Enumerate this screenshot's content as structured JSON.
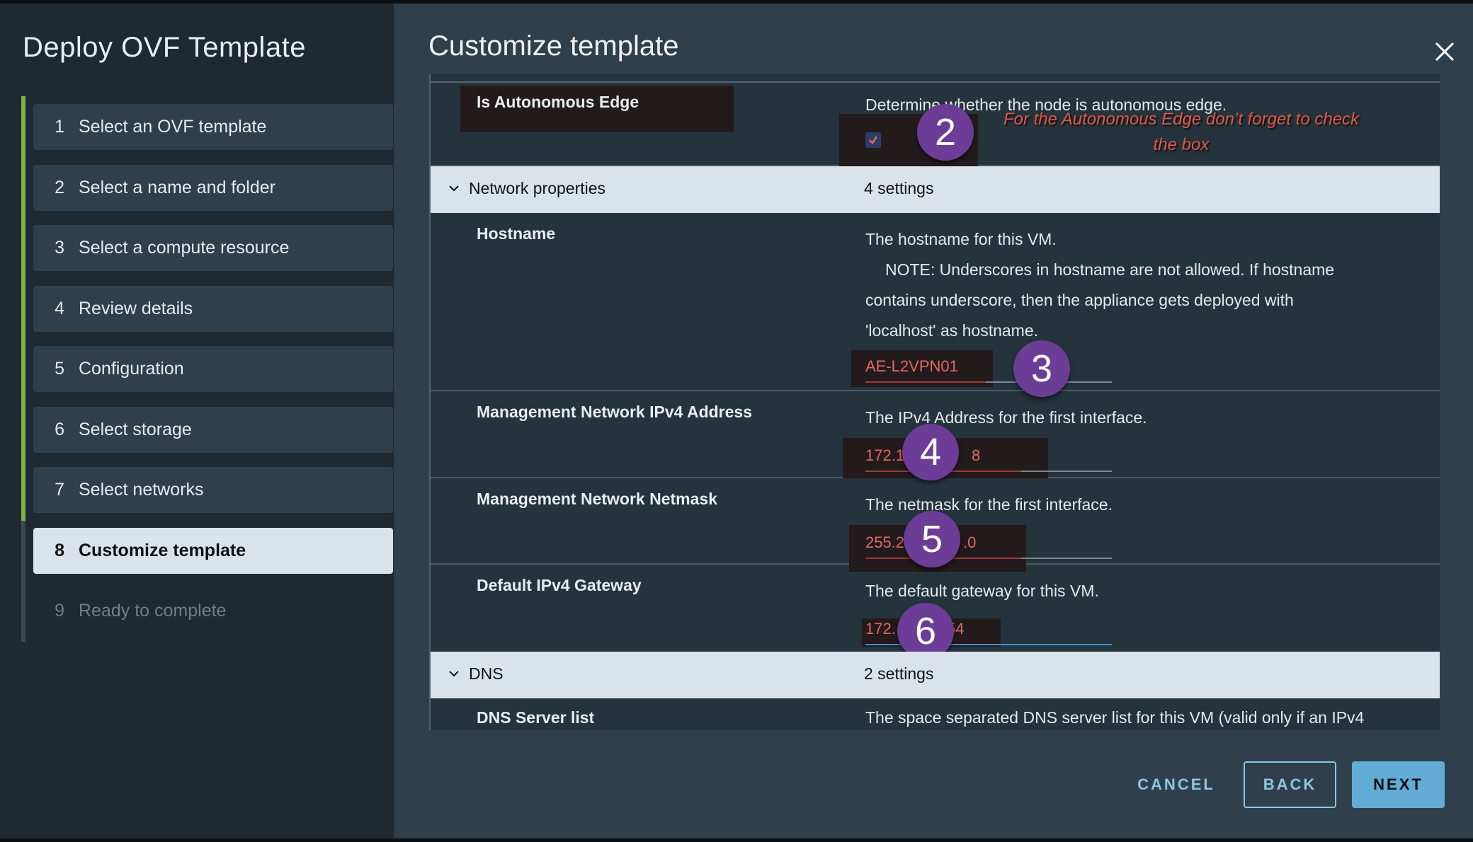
{
  "wizard": {
    "title": "Deploy OVF Template",
    "progress_completed_steps": 7,
    "progress_total_steps": 9,
    "steps": [
      {
        "num": "1",
        "label": "Select an OVF template",
        "state": "done"
      },
      {
        "num": "2",
        "label": "Select a name and folder",
        "state": "done"
      },
      {
        "num": "3",
        "label": "Select a compute resource",
        "state": "done"
      },
      {
        "num": "4",
        "label": "Review details",
        "state": "done"
      },
      {
        "num": "5",
        "label": "Configuration",
        "state": "done"
      },
      {
        "num": "6",
        "label": "Select storage",
        "state": "done"
      },
      {
        "num": "7",
        "label": "Select networks",
        "state": "done"
      },
      {
        "num": "8",
        "label": "Customize template",
        "state": "active"
      },
      {
        "num": "9",
        "label": "Ready to complete",
        "state": "future"
      }
    ]
  },
  "page": {
    "title": "Customize template",
    "close_icon": "close-icon"
  },
  "properties": {
    "autonomous_edge": {
      "label": "Is Autonomous Edge",
      "description": "Determine whether the node is autonomous edge.",
      "checked": true
    },
    "network_group": {
      "name": "Network properties",
      "count": "4 settings",
      "expanded": true
    },
    "hostname": {
      "label": "Hostname",
      "desc_line1": "The hostname for this VM.",
      "desc_line2": "NOTE: Underscores in hostname are not allowed.  If hostname",
      "desc_line3": "contains underscore, then the appliance gets deployed with",
      "desc_line4": "'localhost' as hostname.",
      "value": "AE-L2VPN01"
    },
    "mgmt_ipv4": {
      "label": "Management Network IPv4 Address",
      "description": "The IPv4 Address for the first interface.",
      "value_visible_start": "172.1",
      "value_visible_end": "8"
    },
    "mgmt_netmask": {
      "label": "Management Network Netmask",
      "description": "The netmask for the first interface.",
      "value_visible_start": "255.2",
      "value_visible_end": ".0"
    },
    "default_gateway": {
      "label": "Default IPv4 Gateway",
      "description": "The default gateway for this VM.",
      "value_visible_start": "172.",
      "value_visible_end": "54"
    },
    "dns_group": {
      "name": "DNS",
      "count": "2 settings",
      "expanded": true
    },
    "dns_servers": {
      "label": "DNS Server list",
      "description": "The space separated DNS server list for this VM (valid only if an IPv4"
    }
  },
  "annotations": {
    "note_line1": "For the Autonomous Edge don’t  forget to check",
    "note_line2": "the box",
    "badges": [
      "2",
      "3",
      "4",
      "5",
      "6"
    ],
    "badge_color": "#6c3d96",
    "note_color": "#e0564a"
  },
  "footer": {
    "cancel_label": "CANCEL",
    "back_label": "BACK",
    "next_label": "NEXT"
  },
  "colors": {
    "progress_green": "#7cb342",
    "primary_button": "#62acd6",
    "redaction_text": "#e06a60"
  }
}
